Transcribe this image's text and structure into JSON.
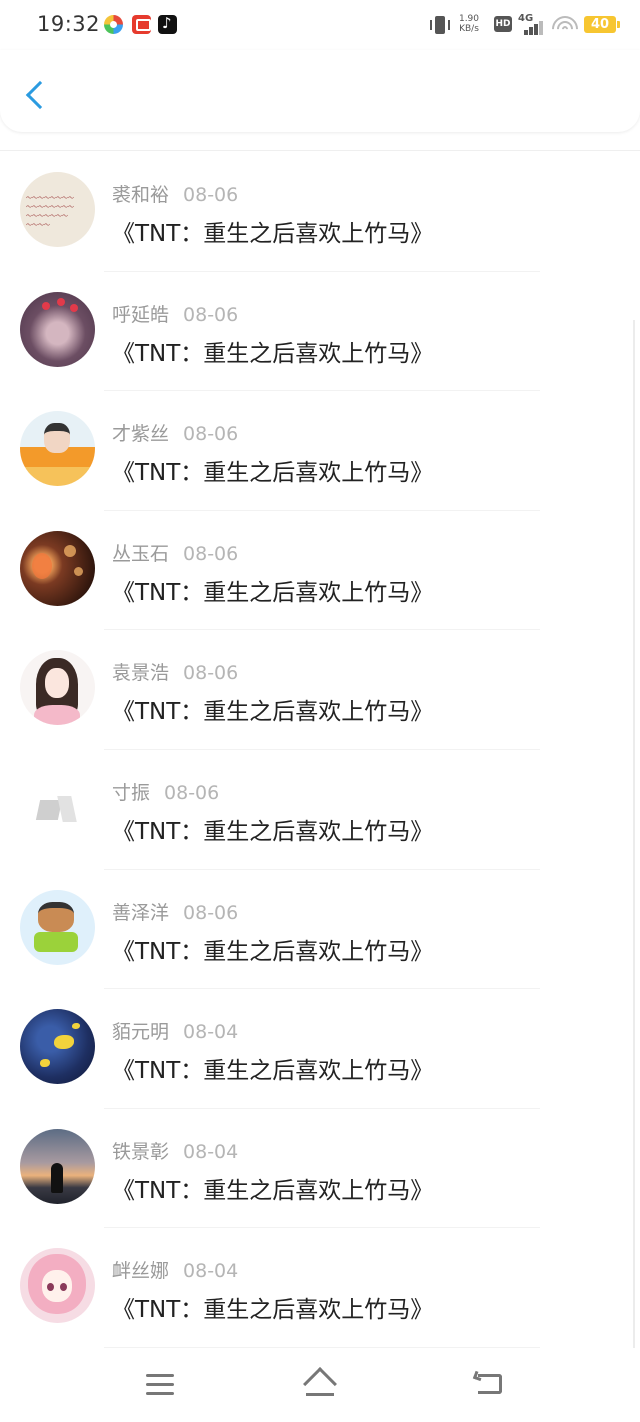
{
  "status_bar": {
    "time": "19:32",
    "speed_value": "1.90",
    "speed_unit": "KB/s",
    "hd": "HD",
    "network": "4G",
    "battery": "40"
  },
  "header": {
    "back_icon": "chevron-left-icon"
  },
  "items": [
    {
      "name": "裘和裕",
      "date": "08-06",
      "title": "《TNT：重生之后喜欢上竹马》"
    },
    {
      "name": "呼延皓",
      "date": "08-06",
      "title": "《TNT：重生之后喜欢上竹马》"
    },
    {
      "name": "才紫丝",
      "date": "08-06",
      "title": "《TNT：重生之后喜欢上竹马》"
    },
    {
      "name": "丛玉石",
      "date": "08-06",
      "title": "《TNT：重生之后喜欢上竹马》"
    },
    {
      "name": "袁景浩",
      "date": "08-06",
      "title": "《TNT：重生之后喜欢上竹马》"
    },
    {
      "name": "寸振",
      "date": "08-06",
      "title": "《TNT：重生之后喜欢上竹马》"
    },
    {
      "name": "善泽洋",
      "date": "08-06",
      "title": "《TNT：重生之后喜欢上竹马》"
    },
    {
      "name": "貊元明",
      "date": "08-04",
      "title": "《TNT：重生之后喜欢上竹马》"
    },
    {
      "name": "铁景彰",
      "date": "08-04",
      "title": "《TNT：重生之后喜欢上竹马》"
    },
    {
      "name": "衅丝娜",
      "date": "08-04",
      "title": "《TNT：重生之后喜欢上竹马》"
    }
  ],
  "bottom_nav": {
    "menu_icon": "menu-icon",
    "home_icon": "home-icon",
    "back_icon": "back-icon"
  },
  "colors": {
    "accent": "#2b9be0",
    "battery": "#f7c631",
    "meta_text": "#9a9a9a"
  }
}
